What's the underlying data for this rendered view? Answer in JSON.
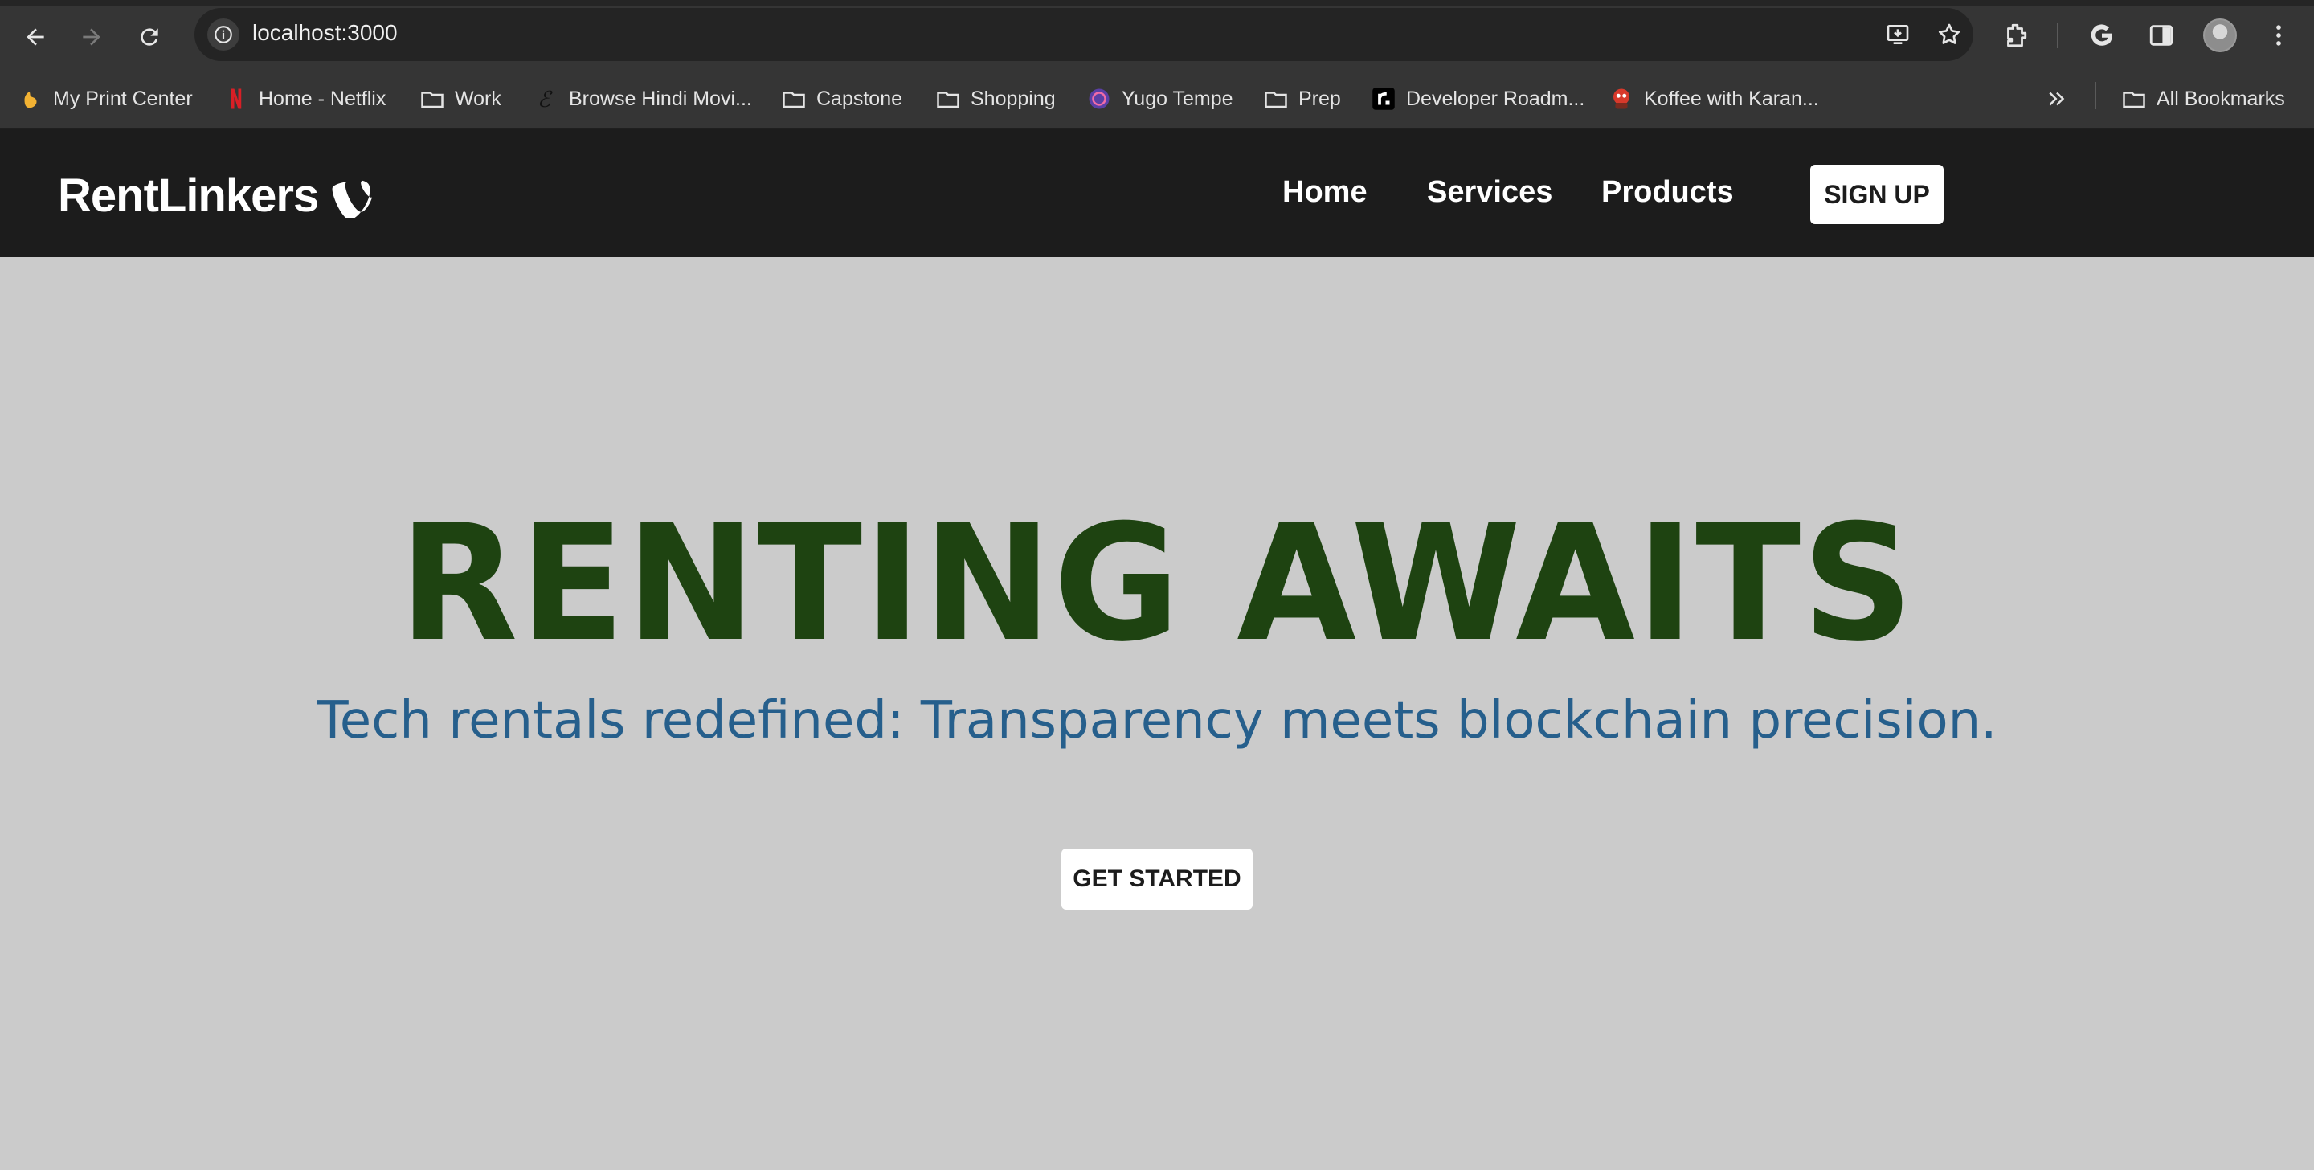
{
  "browser": {
    "url": "localhost:3000",
    "bookmarks": [
      {
        "label": "My Print Center",
        "icon": "hand-icon"
      },
      {
        "label": "Home - Netflix",
        "icon": "netflix-icon"
      },
      {
        "label": "Work",
        "icon": "folder-icon"
      },
      {
        "label": "Browse Hindi Movi...",
        "icon": "script-e-icon"
      },
      {
        "label": "Capstone",
        "icon": "folder-icon"
      },
      {
        "label": "Shopping",
        "icon": "folder-icon"
      },
      {
        "label": "Yugo Tempe",
        "icon": "yugo-icon"
      },
      {
        "label": "Prep",
        "icon": "folder-icon"
      },
      {
        "label": "Developer Roadm...",
        "icon": "roadmap-icon"
      },
      {
        "label": "Koffee with Karan...",
        "icon": "koffee-icon"
      }
    ],
    "all_bookmarks": "All Bookmarks"
  },
  "site": {
    "brand": "RentLinkers",
    "nav": [
      "Home",
      "Services",
      "Products"
    ],
    "signup": "SIGN UP"
  },
  "hero": {
    "title": "RENTING AWAITS",
    "subtitle": "Tech rentals redefined: Transparency meets blockchain precision.",
    "cta": "GET STARTED"
  },
  "colors": {
    "header_bg": "#1c1c1c",
    "hero_bg": "#cbcbcb",
    "title": "#1e4311",
    "subtitle": "#265f8c"
  }
}
